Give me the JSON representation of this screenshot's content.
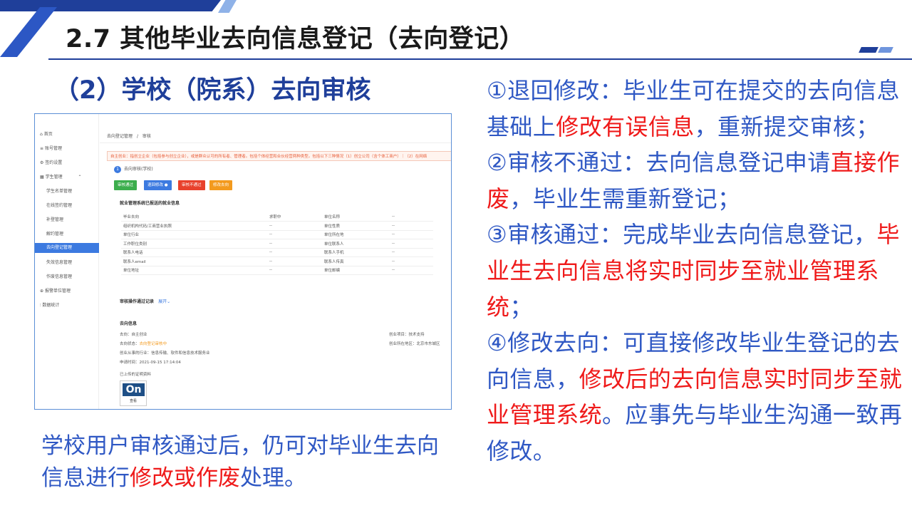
{
  "slide": {
    "title": "2.7 其他毕业去向信息登记（去向登记）",
    "subtitle": "（2）学校（院系）去向审核"
  },
  "screenshot": {
    "sidebar": [
      {
        "label": "首页",
        "icon": "home-icon"
      },
      {
        "label": "账号管理",
        "icon": "user-icon"
      },
      {
        "label": "签约设置",
        "icon": "gear-icon"
      },
      {
        "label": "学生管理",
        "icon": "grid-icon"
      },
      {
        "label": "学生名单管理"
      },
      {
        "label": "在线签约管理"
      },
      {
        "label": "补登管理"
      },
      {
        "label": "解约管理"
      },
      {
        "label": "去向登记管理",
        "active": true
      },
      {
        "label": "失效信息管理"
      },
      {
        "label": "作废信息管理"
      },
      {
        "label": "报警单位管理",
        "icon": "alert-icon"
      },
      {
        "label": "数据统计",
        "icon": "chart-icon"
      }
    ],
    "breadcrumb": {
      "parent": "去向登记管理",
      "sep": "/",
      "current": "审核"
    },
    "alert": "自主创业：指创立企业（包括参与创立企业），或是群众认可的所有者、管理者。包括个体经营和合伙经营两种类型。包括以下三种情况（1）创立公司（含个体工商户）｜（2）在网络",
    "step": {
      "number": "1",
      "label": "去向审核(学校)"
    },
    "buttons": {
      "approve": "审核通过",
      "return": "退回修改",
      "reject": "审核不通过",
      "modify": "修改去向"
    },
    "colors": {
      "approve": "#3cae4d",
      "return": "#3c7ae0",
      "reject": "#e8412c",
      "modify": "#f39a1e",
      "brand": "#1f3f9a",
      "text_blue": "#2f58c4",
      "text_red": "#ef1a1a"
    },
    "employment_title": "就业管理系统已报送的就业信息",
    "employment_table": [
      [
        "毕业去向",
        "求职中",
        "单位名称",
        "--"
      ],
      [
        "组织机构代码/工商营业执照",
        "--",
        "单位性质",
        "--"
      ],
      [
        "单位行业",
        "--",
        "单位所在地",
        "--"
      ],
      [
        "工作职位类别",
        "--",
        "单位联系人",
        "--"
      ],
      [
        "联系人电话",
        "--",
        "联系人手机",
        "--"
      ],
      [
        "联系人email",
        "--",
        "联系人传真",
        "--"
      ],
      [
        "单位地址",
        "--",
        "单位邮编",
        "--"
      ]
    ],
    "audit_log": {
      "title": "审核操作通过记录",
      "expand": "展开"
    },
    "destination": {
      "title": "去向信息",
      "line1": "去向：自主创业",
      "line2_prefix": "去向状态：",
      "line2_status": "去向登记审核中",
      "line3": "创业从事的行业：信息传输、软件和信息技术服务业",
      "line4": "申请时间：2021-09-15 17:14:04",
      "right1": "创业项目：技术支持",
      "right2": "创业所在地区：北京市东城区",
      "uploaded": "已上传的证明资料",
      "cert_logo": "On",
      "cert_caption": "查看"
    }
  },
  "caption": {
    "p1": "学校用户审核通过后，仍可对毕业生去向信息进行",
    "red": "修改或作废",
    "p2": "处理。"
  },
  "notes": {
    "n1_a": "①退回修改：毕业生可在提交的去向信息基础上",
    "n1_red": "修改有误信息",
    "n1_b": "，重新提交审核；",
    "n2_a": "②审核不通过：去向信息登记申请",
    "n2_red": "直接作废",
    "n2_b": "，毕业生需重新登记；",
    "n3_a": "③审核通过：完成毕业去向信息登记，",
    "n3_red": "毕业生去向信息将实时同步至就业管理系统",
    "n3_b": "；",
    "n4_a": "④修改去向：可直接修改毕业生登记的去向信息，",
    "n4_red": "修改后的去向信息实时同步至就业管理系统",
    "n4_b": "。应事先与毕业生沟通一致再修改。"
  }
}
